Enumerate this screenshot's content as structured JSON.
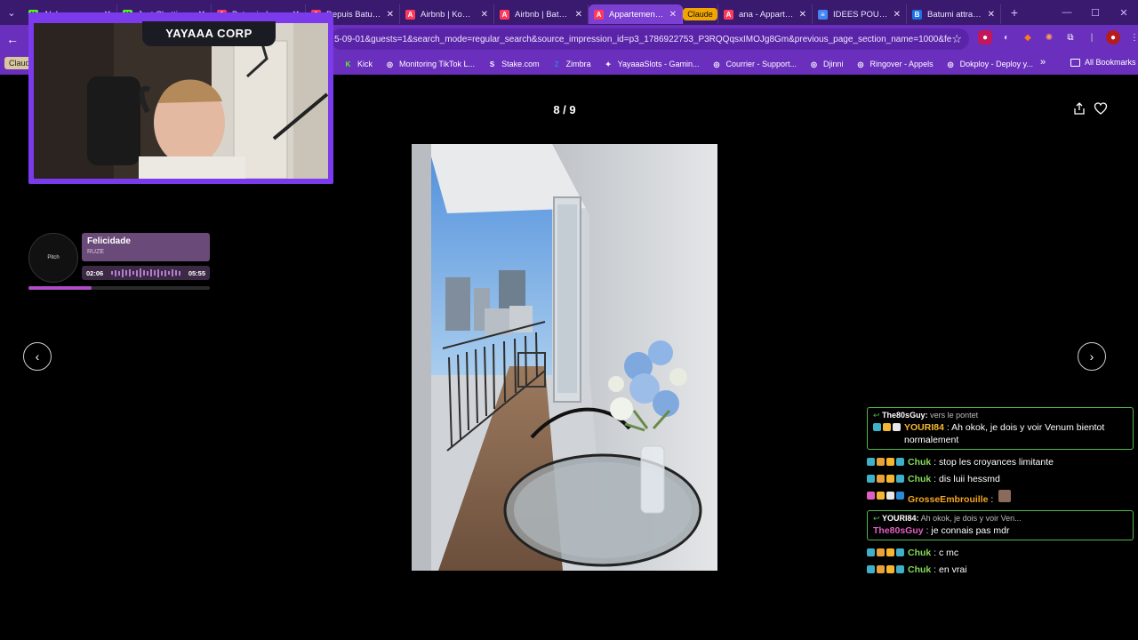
{
  "browser": {
    "tabs": [
      {
        "label": "Alalaa.com",
        "fav": "K",
        "color": "#53fc18",
        "active": false
      },
      {
        "label": "Just Chatting Fr",
        "fav": "K",
        "color": "#53fc18",
        "active": false
      },
      {
        "label": "Batumi - Les Offic",
        "fav": "A",
        "color": "#ff385c",
        "active": false
      },
      {
        "label": "Depuis Batumi à",
        "fav": "A",
        "color": "#ff385c",
        "active": false
      },
      {
        "label": "Airbnb | Kobulet",
        "fav": "A",
        "color": "#ff385c",
        "active": false
      },
      {
        "label": "Airbnb | Batumi",
        "fav": "A",
        "color": "#ff385c",
        "active": false
      },
      {
        "label": "Appartement mo",
        "fav": "A",
        "color": "#ff385c",
        "active": true
      },
      {
        "label": "ana - Appartem",
        "fav": "A",
        "color": "#ff385c",
        "active": false
      },
      {
        "label": "IDEES POUR LE",
        "fav": "≡",
        "color": "#4285f4",
        "active": false
      },
      {
        "label": "Batumi attractio",
        "fav": "B",
        "color": "#1a73e8",
        "active": false
      }
    ],
    "tab_group_label": "Claude",
    "url": "5-09-01&guests=1&search_mode=regular_search&source_impression_id=p3_1786922753_P3RQQqsxIMOJg8Gm&previous_page_section_name=1000&federated_se...",
    "bookmark_group": "Claude",
    "bookmarks": [
      {
        "label": "Kick",
        "icon": "K",
        "color": "#53fc18"
      },
      {
        "label": "Monitoring TikTok L...",
        "icon": "◎",
        "color": "#ffffff"
      },
      {
        "label": "Stake.com",
        "icon": "S",
        "color": "#ffffff"
      },
      {
        "label": "Zimbra",
        "icon": "Z",
        "color": "#1e88e5"
      },
      {
        "label": "YayaaaSlots - Gamin...",
        "icon": "✦",
        "color": "#ffffff"
      },
      {
        "label": "Courrier - Support...",
        "icon": "◎",
        "color": "#ffffff"
      },
      {
        "label": "Djinni",
        "icon": "◎",
        "color": "#ffffff"
      },
      {
        "label": "Ringover - Appels",
        "icon": "◎",
        "color": "#ffffff"
      },
      {
        "label": "Dokploy - Deploy y...",
        "icon": "◎",
        "color": "#ffffff"
      }
    ],
    "all_bookmarks": "All Bookmarks"
  },
  "gallery": {
    "counter": "8 / 9"
  },
  "overlay": {
    "channel_title": "YAYAAA CORP",
    "music": {
      "title": "Felicidade",
      "artist": "RUZE",
      "elapsed": "02:06",
      "duration": "05:55",
      "progress": 0.35,
      "album_text": "Pitch"
    },
    "chat": [
      {
        "type": "reply",
        "reply_to_user": "The80sGuy:",
        "reply_to_text": "vers le pontet",
        "user": "YOURI84",
        "user_color": "#f5b731",
        "text": "Ah okok, je dois y voir Venum bientot normalement"
      },
      {
        "type": "msg",
        "user": "Chuk",
        "user_color": "#84d95a",
        "text": "stop les croyances limitante"
      },
      {
        "type": "msg",
        "user": "Chuk",
        "user_color": "#84d95a",
        "text": "dis luii hessmd"
      },
      {
        "type": "msg",
        "user": "GrosseEmbrouille",
        "user_color": "#f5a623",
        "text": ""
      },
      {
        "type": "reply",
        "reply_to_user": "YOURI84:",
        "reply_to_text": "Ah okok, je dois y voir Ven...",
        "user": "The80sGuy",
        "user_color": "#e060c0",
        "text": "je connais pas mdr"
      },
      {
        "type": "msg",
        "user": "Chuk",
        "user_color": "#84d95a",
        "text": "c mc"
      },
      {
        "type": "msg",
        "user": "Chuk",
        "user_color": "#84d95a",
        "text": "en vrai"
      }
    ]
  }
}
